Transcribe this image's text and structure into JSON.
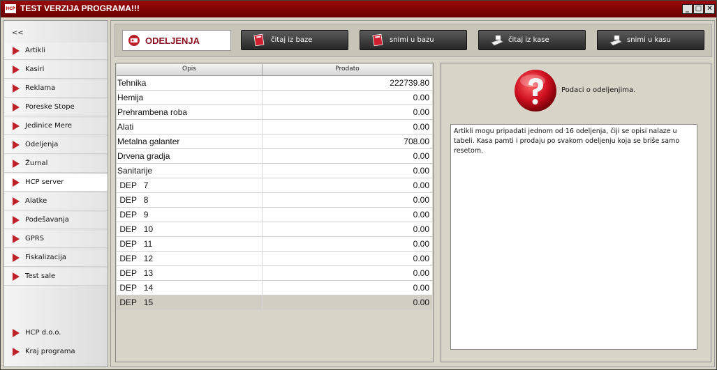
{
  "window": {
    "logo_text": "HCP",
    "title": "TEST VERZIJA PROGRAMA!!!",
    "minimize_label": "_",
    "maximize_label": "□",
    "close_label": "✕"
  },
  "sidebar": {
    "collapse_label": "<<",
    "items": [
      {
        "label": "Artikli"
      },
      {
        "label": "Kasiri"
      },
      {
        "label": "Reklama"
      },
      {
        "label": "Poreske Stope"
      },
      {
        "label": "Jedinice Mere"
      },
      {
        "label": "Odeljenja"
      },
      {
        "label": "Žurnal"
      },
      {
        "label": "HCP server"
      },
      {
        "label": "Alatke"
      },
      {
        "label": "Podešavanja"
      },
      {
        "label": "GPRS"
      },
      {
        "label": "Fiskalizacija"
      },
      {
        "label": "Test sale"
      }
    ],
    "bottom_items": [
      {
        "label": "HCP d.o.o."
      },
      {
        "label": "Kraj programa"
      }
    ]
  },
  "toolbar": {
    "section_title": "ODELJENJA",
    "buttons": [
      {
        "label": "čitaj iz baze",
        "icon": "database-read-icon"
      },
      {
        "label": "snimi u bazu",
        "icon": "database-save-icon"
      },
      {
        "label": "čitaj iz kase",
        "icon": "register-read-icon"
      },
      {
        "label": "snimi u kasu",
        "icon": "register-save-icon"
      }
    ]
  },
  "table": {
    "columns": [
      "Opis",
      "Prodato"
    ],
    "rows": [
      {
        "opis": "Tehnika",
        "prodato": "222739.80"
      },
      {
        "opis": "Hemija",
        "prodato": "0.00"
      },
      {
        "opis": "Prehrambena roba",
        "prodato": "0.00"
      },
      {
        "opis": "Alati",
        "prodato": "0.00"
      },
      {
        "opis": "Metalna galanter",
        "prodato": "708.00"
      },
      {
        "opis": "Drvena gradja",
        "prodato": "0.00"
      },
      {
        "opis": "Sanitarije",
        "prodato": "0.00"
      },
      {
        "opis": " DEP   7",
        "prodato": "0.00"
      },
      {
        "opis": " DEP   8",
        "prodato": "0.00"
      },
      {
        "opis": " DEP   9",
        "prodato": "0.00"
      },
      {
        "opis": " DEP   10",
        "prodato": "0.00"
      },
      {
        "opis": " DEP   11",
        "prodato": "0.00"
      },
      {
        "opis": " DEP   12",
        "prodato": "0.00"
      },
      {
        "opis": " DEP   13",
        "prodato": "0.00"
      },
      {
        "opis": " DEP   14",
        "prodato": "0.00"
      },
      {
        "opis": " DEP   15",
        "prodato": "0.00"
      }
    ]
  },
  "info": {
    "title": "Podaci o odeljenjima.",
    "text": "Artikli mogu pripadati jednom od 16 odeljenja, čiji se opisi nalaze u tabeli. Kasa pamti i prodaju po svakom odeljenju koja se briše samo resetom."
  },
  "colors": {
    "accent": "#8a1020",
    "title_bar": "#9a0a0a",
    "nav_marker": "#c0202a"
  }
}
